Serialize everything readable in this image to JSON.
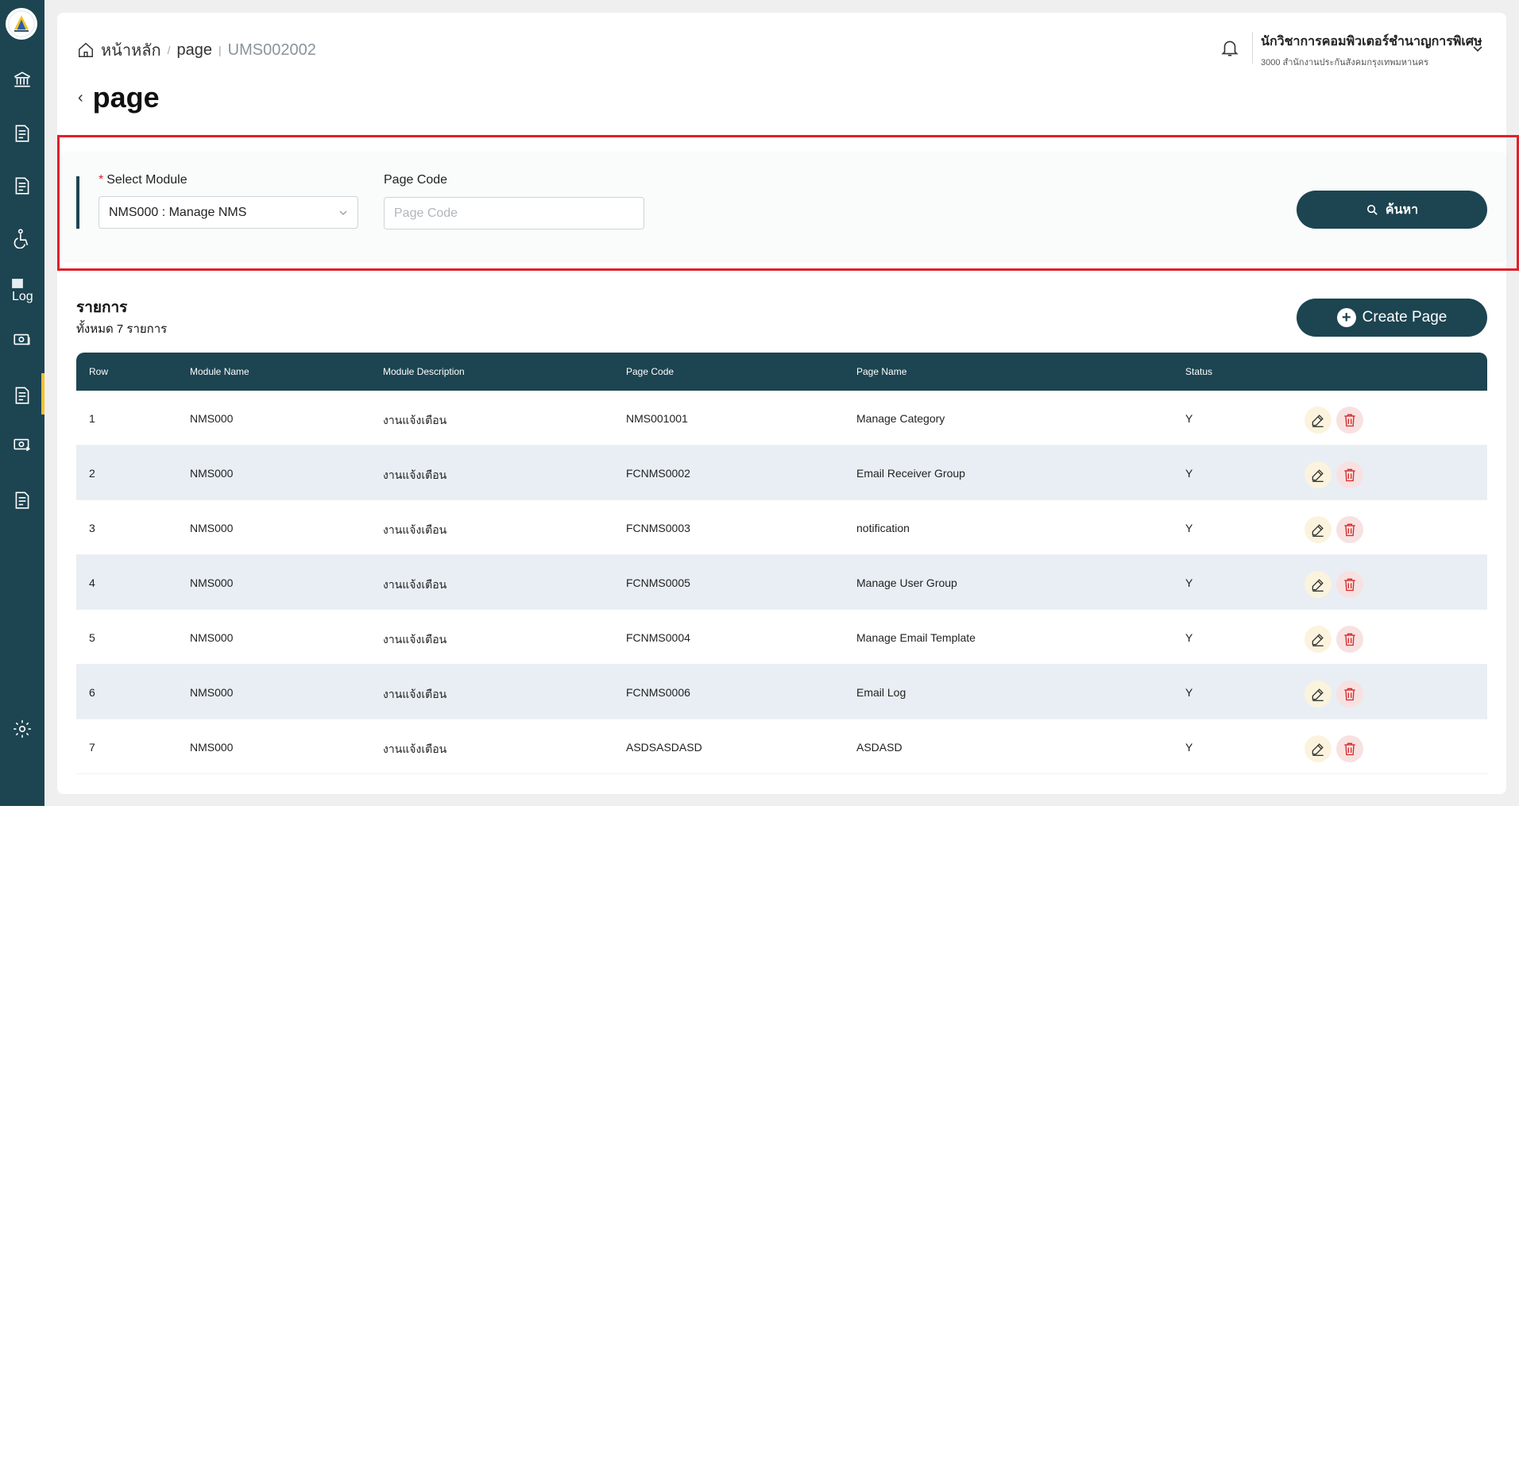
{
  "breadcrumb": {
    "home": "หน้าหลัก",
    "section": "page",
    "code": "UMS002002"
  },
  "page": {
    "title": "page"
  },
  "user": {
    "name": "นักวิชาการคอมพิวเตอร์ชำนาญการพิเศษ",
    "org": "3000 สำนักงานประกันสังคมกรุงเทพมหานคร"
  },
  "sidebar": {
    "items": [
      "bank-icon",
      "document-icon",
      "document-icon",
      "accessibility-icon",
      "broken-image",
      "money-refresh-icon",
      "document-icon",
      "money-return-icon",
      "document-icon",
      "gear-icon"
    ],
    "broken_image_alt": "Log"
  },
  "filter": {
    "module_label": "Select Module",
    "module_required": "*",
    "module_value": "NMS000 : Manage NMS",
    "page_code_label": "Page Code",
    "page_code_placeholder": "Page Code",
    "search_label": "ค้นหา"
  },
  "list": {
    "title": "รายการ",
    "count_text": "ทั้งหมด 7 รายการ",
    "create_label": "Create Page"
  },
  "table": {
    "headers": [
      "Row",
      "Module Name",
      "Module Description",
      "Page Code",
      "Page Name",
      "Status"
    ],
    "rows": [
      [
        "1",
        "NMS000",
        "งานแจ้งเตือน",
        "NMS001001",
        "Manage Category",
        "Y"
      ],
      [
        "2",
        "NMS000",
        "งานแจ้งเตือน",
        "FCNMS0002",
        "Email Receiver Group",
        "Y"
      ],
      [
        "3",
        "NMS000",
        "งานแจ้งเตือน",
        "FCNMS0003",
        "notification",
        "Y"
      ],
      [
        "4",
        "NMS000",
        "งานแจ้งเตือน",
        "FCNMS0005",
        "Manage User Group",
        "Y"
      ],
      [
        "5",
        "NMS000",
        "งานแจ้งเตือน",
        "FCNMS0004",
        "Manage Email Template",
        "Y"
      ],
      [
        "6",
        "NMS000",
        "งานแจ้งเตือน",
        "FCNMS0006",
        "Email Log",
        "Y"
      ],
      [
        "7",
        "NMS000",
        "งานแจ้งเตือน",
        "ASDSASDASD",
        "ASDASD",
        "Y"
      ]
    ]
  },
  "colors": {
    "primary": "#1d4451",
    "accent": "#f2c12e",
    "danger": "#e0202a",
    "row_alt": "#e8eef4"
  }
}
